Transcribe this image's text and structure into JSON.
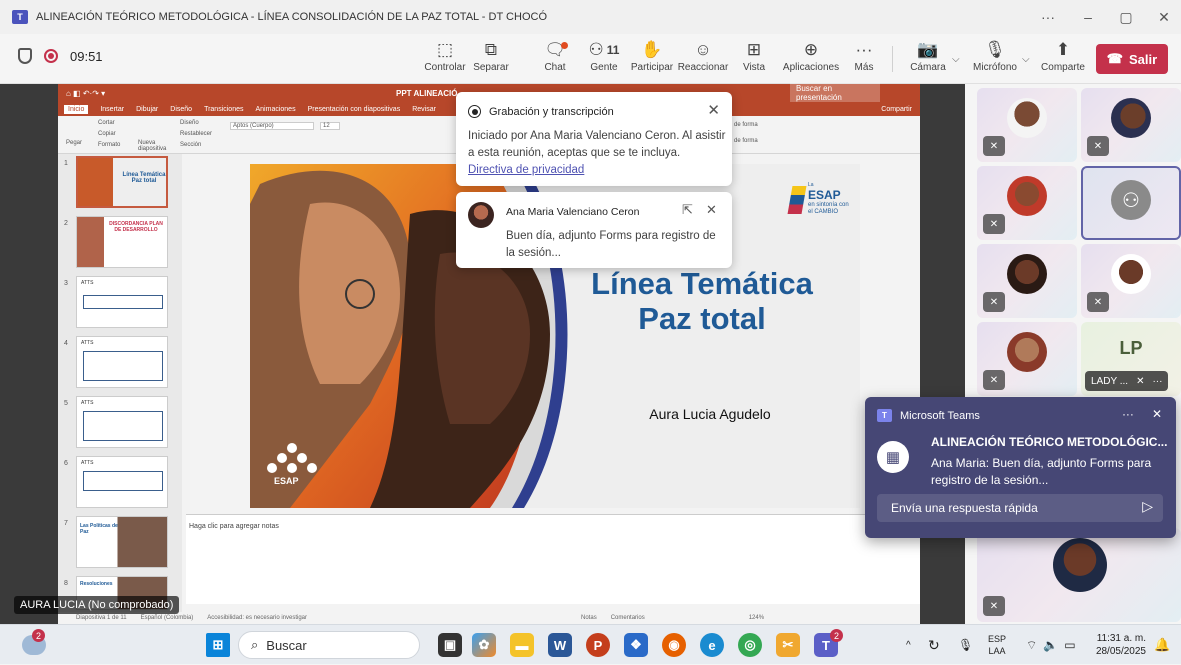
{
  "window": {
    "title": "ALINEACIÓN TEÓRICO METODOLÓGICA - LÍNEA CONSOLIDACIÓN DE LA PAZ TOTAL - DT CHOCÓ",
    "controls": [
      "···",
      "–",
      "▢",
      "✕"
    ]
  },
  "meeting": {
    "elapsed": "09:51",
    "participants_count": "11",
    "toolbar": {
      "controlar": "Controlar",
      "separar": "Separar",
      "chat": "Chat",
      "gente": "Gente",
      "participar": "Participar",
      "reaccionar": "Reaccionar",
      "vista": "Vista",
      "aplicaciones": "Aplicaciones",
      "mas": "Más",
      "camara": "Cámara",
      "microfono": "Micrófono",
      "comparte": "Comparte",
      "salir": "Salir"
    }
  },
  "recording_popup": {
    "title": "Grabación y transcripción",
    "body": "Iniciado por Ana Maria Valenciano Ceron. Al asistir a esta reunión, aceptas que se te incluya.",
    "link": "Directiva de privacidad"
  },
  "chat_popup": {
    "sender": "Ana Maria Valenciano Ceron",
    "message": "Buen día, adjunto Forms para registro de la sesión..."
  },
  "powerpoint": {
    "file_title": "PPT ALINEACIÓ",
    "search": "Buscar en presentación",
    "tabs": [
      "Inicio",
      "Insertar",
      "Dibujar",
      "Diseño",
      "Transiciones",
      "Animaciones",
      "Presentación con diapositivas",
      "Revisar"
    ],
    "share": "Compartir",
    "ribbon": {
      "pegar": "Pegar",
      "cortar": "Cortar",
      "copiar": "Copiar",
      "formato": "Formato",
      "nueva": "Nueva diapositiva",
      "diseno": "Diseño",
      "restablecer": "Restablecer",
      "seccion": "Sección",
      "font": "Aptos (Cuerpo)",
      "size": "12",
      "forma1": "de forma",
      "forma2": "de forma"
    },
    "thumb_labels": [
      "Línea Temática Paz total",
      "DISCORDANCIA PLAN DE DESARROLLO",
      "ATTS",
      "ATTS",
      "ATTS",
      "ATTS",
      "Las Políticas de Paz",
      "Resoluciones"
    ],
    "notes_placeholder": "Haga clic para agregar notas",
    "status": {
      "slide": "Diapositiva 1 de 11",
      "lang": "Español (Colombia)",
      "access": "Accesibilidad: es necesario investigar",
      "notas": "Notas",
      "comentarios": "Comentarios",
      "zoom": "124%"
    },
    "slide": {
      "title": "Línea Temática Paz total",
      "author": "Aura Lucia Agudelo",
      "brand": "ESAP",
      "brand_sub": "en sintonía con el CAMBIO",
      "brand_prefix": "La",
      "footer_logo": "ESAP"
    }
  },
  "speaker_label": "AURA LUCIA (No comprobado)",
  "gallery": {
    "initials": "LP",
    "lady_name": "LADY ..."
  },
  "toast": {
    "app": "Microsoft Teams",
    "title": "ALINEACIÓN TEÓRICO METODOLÓGIC...",
    "message": "Ana Maria: Buen día, adjunto Forms para registro de la sesión...",
    "reply": "Envía una respuesta rápida"
  },
  "taskbar": {
    "search": "Buscar",
    "weather_badge": "2",
    "teams_badge": "2",
    "lang1": "ESP",
    "lang2": "LAA",
    "time": "11:31 a. m.",
    "date": "28/05/2025"
  },
  "colors": {
    "teams_purple": "#464775",
    "leave_red": "#c4314b",
    "ppt_orange": "#b7472a",
    "slide_blue": "#1f5a96"
  }
}
